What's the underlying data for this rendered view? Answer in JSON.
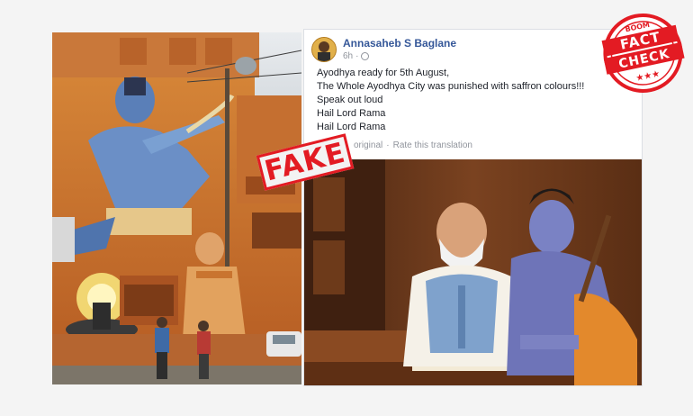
{
  "post": {
    "author": "Annasaheb S Baglane",
    "time": "6h",
    "more_label": "···",
    "lines": [
      "Ayodhya ready for 5th August,",
      "The Whole Ayodhya City was punished with saffron colours!!!",
      "Speak out loud",
      "Hail Lord Rama",
      "Hail Lord Rama"
    ],
    "see_original": "original",
    "rate_translation": "Rate this translation"
  },
  "stamp": {
    "label": "FAKE"
  },
  "logo": {
    "brand": "BOOM",
    "line1": "FACT",
    "line2": "CHECK",
    "stars": "★★★"
  },
  "colors": {
    "fb_link": "#365899",
    "stamp_red": "#e31b23",
    "saffron": "#d9772c"
  }
}
